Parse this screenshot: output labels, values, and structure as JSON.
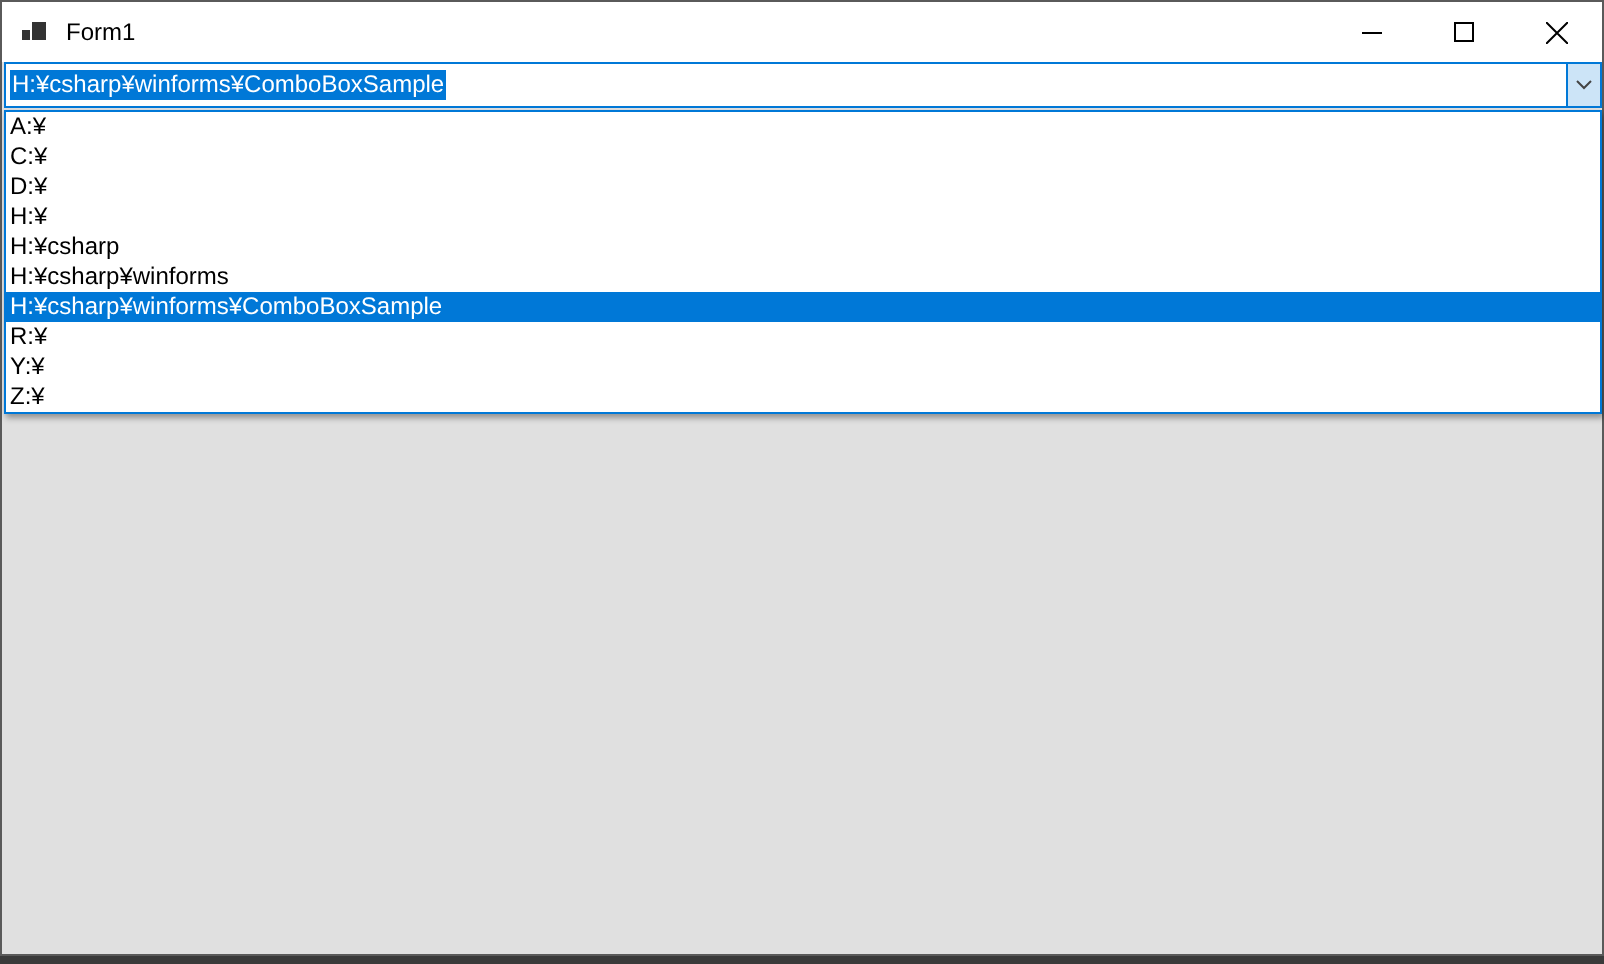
{
  "window": {
    "title": "Form1"
  },
  "combo": {
    "value": "H:¥csharp¥winforms¥ComboBoxSample",
    "expanded": true
  },
  "items": [
    {
      "label": "A:¥",
      "selected": false
    },
    {
      "label": "C:¥",
      "selected": false
    },
    {
      "label": "D:¥",
      "selected": false
    },
    {
      "label": "H:¥",
      "selected": false
    },
    {
      "label": "H:¥csharp",
      "selected": false
    },
    {
      "label": "H:¥csharp¥winforms",
      "selected": false
    },
    {
      "label": "H:¥csharp¥winforms¥ComboBoxSample",
      "selected": true
    },
    {
      "label": "R:¥",
      "selected": false
    },
    {
      "label": "Y:¥",
      "selected": false
    },
    {
      "label": "Z:¥",
      "selected": false
    }
  ]
}
